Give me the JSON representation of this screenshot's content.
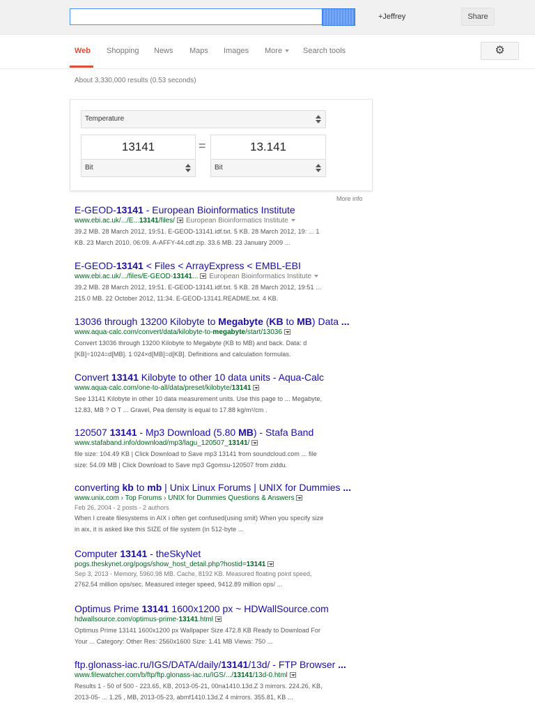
{
  "header": {
    "search_value": "",
    "user_label": "+Jeffrey",
    "share_label": "Share"
  },
  "nav": {
    "tabs": [
      "Web",
      "Shopping",
      "News",
      "Maps",
      "Images",
      "More",
      "Search tools"
    ],
    "active_tab": "Web"
  },
  "stats": "About 3,330,000 results (0.53 seconds)",
  "converter": {
    "category": "Temperature",
    "left_value": "13141",
    "right_value": "13.141",
    "equals": "=",
    "left_unit": "Bit",
    "right_unit": "Bit",
    "more_info": "More info"
  },
  "results": [
    {
      "title": [
        "E-GEOD-",
        "13141",
        " - European Bioinformatics Institute"
      ],
      "url": [
        "www.ebi.ac.uk/.../E...",
        "13141",
        "/files/"
      ],
      "source": "European Bioinformatics Institute",
      "meta": "",
      "snippet": [
        "39.2 MB. 28 March 2012, 19:51. E-GEOD-13141.idf.txt. 5 KB. 28 March 2012, 19: ... 1",
        "KB. 23 March 2010, 06:09. A-AFFY-44.cdf.zip. 33.6 MB. 23 January 2009 ..."
      ]
    },
    {
      "title": [
        "E-GEOD-",
        "13141",
        " < Files < ArrayExpress < EMBL-EBI"
      ],
      "url": [
        "www.ebi.ac.uk/.../files/E-GEOD-",
        "13141",
        "..."
      ],
      "source": "European Bioinformatics Institute",
      "meta": "",
      "snippet": [
        "39.2 MB. 28 March 2012, 19:51. E-GEOD-13141.idf.txt. 5 KB. 28 March 2012, 19:51 ...",
        "215.0 MB. 22 October 2012, 11:34. E-GEOD-13141.README.txt. 4 KB."
      ]
    },
    {
      "title": [
        "13036 through 13200 Kilobyte to ",
        "Megabyte",
        " (",
        "KB",
        " to ",
        "MB",
        ") Data ",
        "..."
      ],
      "url": [
        "www.aqua-calc.com/convert/data/kilobyte-to-",
        "megabyte",
        "/start/13036"
      ],
      "source": "",
      "meta": "",
      "snippet": [
        "Convert 13036 through 13200 Kilobyte to Megabyte (KB to MB) and back. Data: d",
        "[KB]÷1024=d[MB]. 1 024×d[MB]=d[KB]. Definitions and calculation formulas."
      ]
    },
    {
      "title": [
        "Convert ",
        "13141",
        " Kilobyte to other 10 data units - Aqua-Calc"
      ],
      "url": [
        "www.aqua-calc.com/one-to-all/data/preset/kilobyte/",
        "13141",
        ""
      ],
      "source": "",
      "meta": "",
      "snippet": [
        "See 13141 Kilobyte in other 10 data measurement units. Use this page to ... Megabyte,",
        "12.83, MB ? O T ... Gravel, Pea density is equal to 17.88 kg/m²/cm ."
      ]
    },
    {
      "title": [
        "120507 ",
        "13141",
        " - Mp3 Download (5.80 ",
        "MB",
        ") - Stafa Band"
      ],
      "url": [
        "www.stafaband.info/download/mp3/lagu_120507_",
        "13141",
        "/"
      ],
      "source": "",
      "meta": "",
      "snippet": [
        "file size: 104.49 KB | Click Download to Save mp3 13141 from soundcloud.com ... file",
        "size: 54.09 MB | Click Download to Save mp3 Ggomsu-120507 from ziddu."
      ]
    },
    {
      "title": [
        "converting ",
        "kb",
        " to ",
        "mb",
        " | Unix Linux Forums | UNIX for Dummies ",
        "..."
      ],
      "url": [
        "www.unix.com › Top Forums › UNIX for Dummies Questions & Answers",
        "",
        ""
      ],
      "source": "",
      "meta": "Feb 26, 2004 - 2 posts - 2 authors",
      "snippet": [
        "When I create filesystems in AIX i often get confused(using smit) When you specify size",
        "in aix, it is asked like this SIZE of file system (in 512-byte ..."
      ]
    },
    {
      "title": [
        "Computer ",
        "13141",
        " - theSkyNet"
      ],
      "url": [
        "pogs.theskynet.org/pogs/show_host_detail.php?hostid=",
        "13141",
        ""
      ],
      "source": "",
      "meta": "Sep 3, 2013 - Memory, 5960.98 MB. Cache, 8192 KB. Measured floating point speed,",
      "snippet": [
        "2762.54 million ops/sec. Measured integer speed, 9412.89 million ops/ ..."
      ]
    },
    {
      "title": [
        "Optimus Prime ",
        "13141",
        " 1600x1200 px ~ HDWallSource.com"
      ],
      "url": [
        "hdwallsource.com/optimus-prime-",
        "13141",
        ".html"
      ],
      "source": "",
      "meta": "",
      "snippet": [
        "Optimus Prime 13141 1600x1200 px Wallpaper Size 472.8 KB Ready to Download For",
        "Your ... Category: Other Res: 2560x1600 Size: 1.41 MB Views: 750 ..."
      ]
    },
    {
      "title": [
        "ftp.glonass-iac.ru/IGS/DATA/daily/",
        "13141",
        "/13d/ - FTP Browser ",
        "..."
      ],
      "url": [
        "www.filewatcher.com/b/ftp/ftp.glonass-iac.ru/IGS/.../",
        "13141",
        "/13d-0.html"
      ],
      "source": "",
      "meta": "",
      "snippet": [
        "Results 1 - 50 of 500 - 223.65, KB, 2013-05-21, 00na1410.13d.Z 3 mirrors. 224.26, KB,",
        "2013-05- ... 1.25 , MB, 2013-05-23, abmf1410.13d.Z 4 mirrors. 355.81, KB ..."
      ]
    }
  ]
}
